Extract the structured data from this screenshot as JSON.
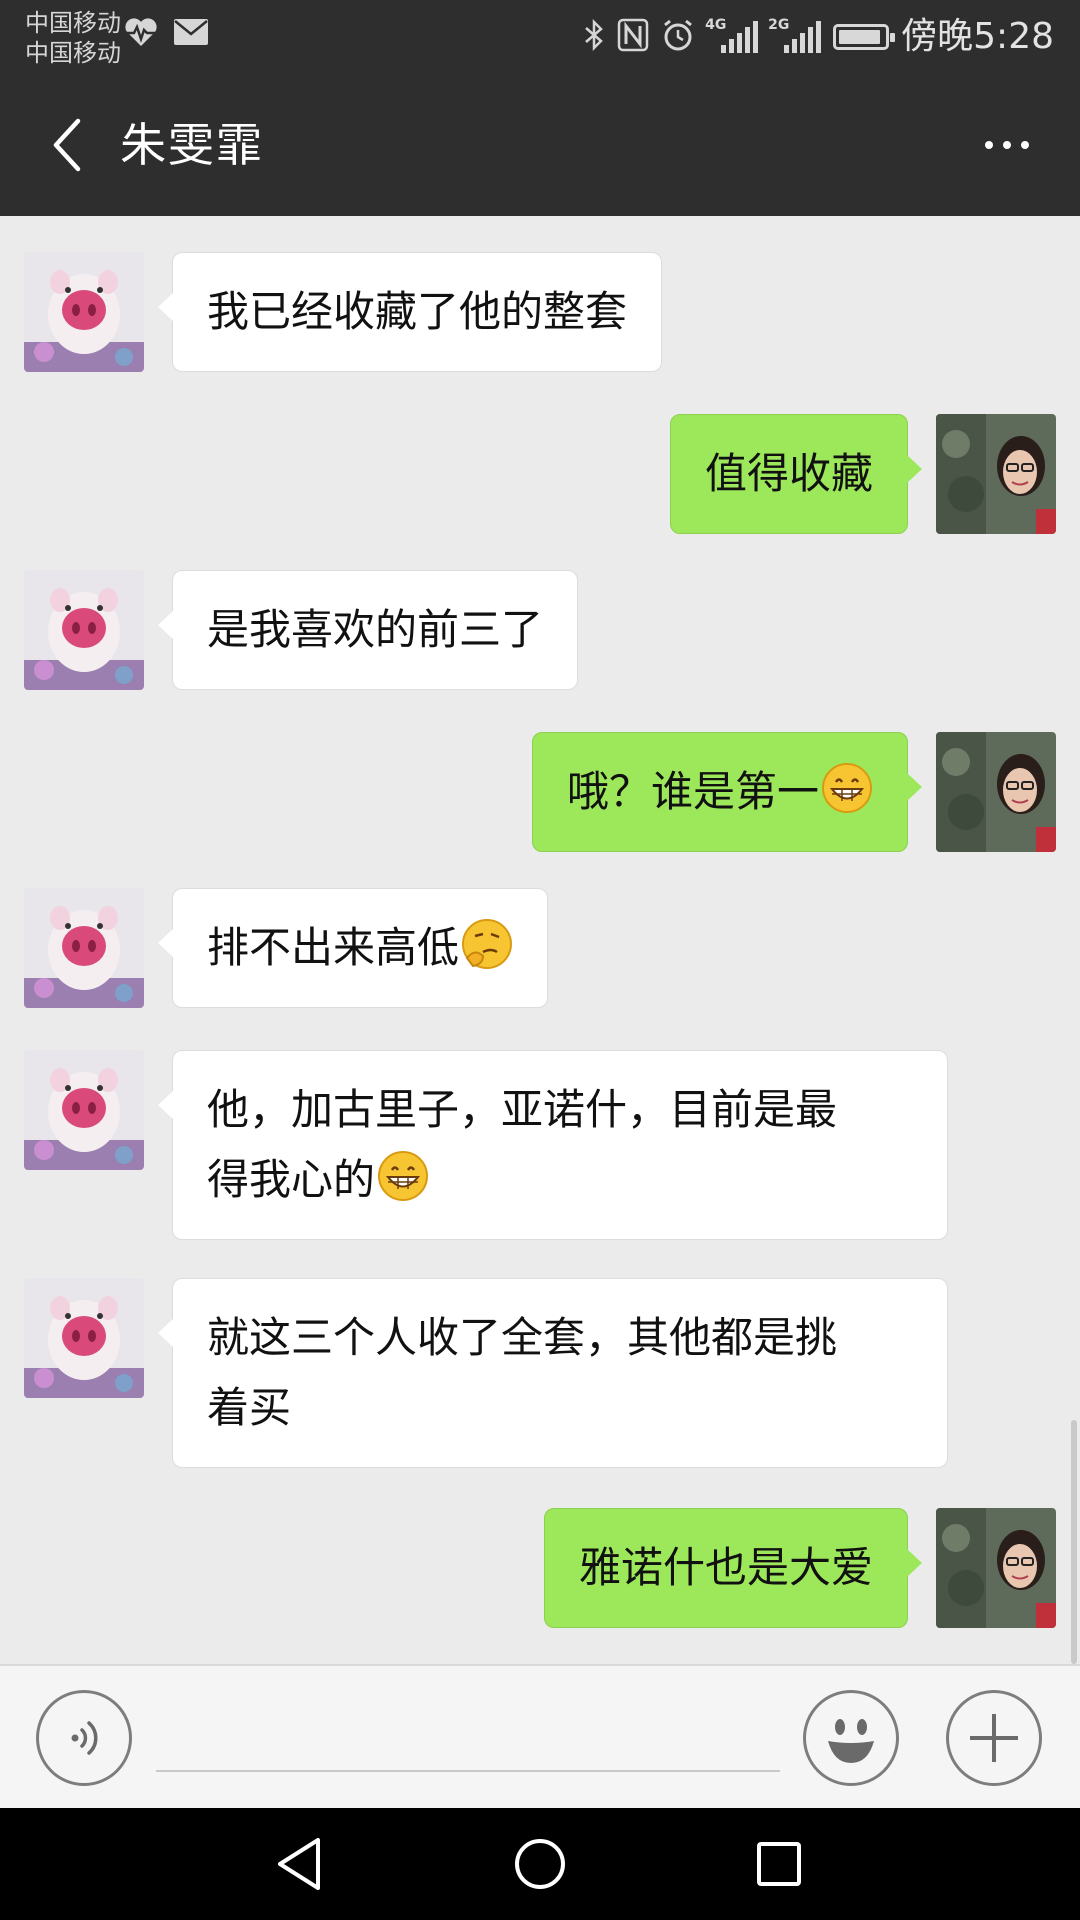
{
  "status_bar": {
    "carrier_1": "中国移动",
    "carrier_2": "中国移动",
    "time": "傍晚5:28",
    "network_tag_1": "4G",
    "network_tag_2": "2G",
    "icons": [
      "heart-pulse-icon",
      "mail-icon",
      "bluetooth-icon",
      "nfc-icon",
      "alarm-icon",
      "signal-icon",
      "signal-icon",
      "battery-icon"
    ]
  },
  "header": {
    "title": "朱雯霏"
  },
  "messages": [
    {
      "side": "in",
      "text": "我已经收藏了他的整套"
    },
    {
      "side": "out",
      "text": "值得收藏"
    },
    {
      "side": "in",
      "text": "是我喜欢的前三了"
    },
    {
      "side": "out",
      "text": "哦？谁是第一",
      "emoji": "grin-emoji"
    },
    {
      "side": "in",
      "text": "排不出来高低",
      "emoji": "thinking-emoji"
    },
    {
      "side": "in",
      "text_line1": "他，加古里子，亚诺什，目前是最",
      "text_line2": "得我心的",
      "emoji": "grin-emoji"
    },
    {
      "side": "in",
      "text_line1": "就这三个人收了全套，其他都是挑",
      "text_line2": "着买"
    },
    {
      "side": "out",
      "text": "雅诺什也是大爱"
    }
  ],
  "input_bar": {
    "placeholder": ""
  },
  "colors": {
    "header_bg": "#2e2e2e",
    "chat_bg": "#ebebeb",
    "outgoing_bubble": "#9de85a",
    "incoming_bubble": "#ffffff"
  }
}
